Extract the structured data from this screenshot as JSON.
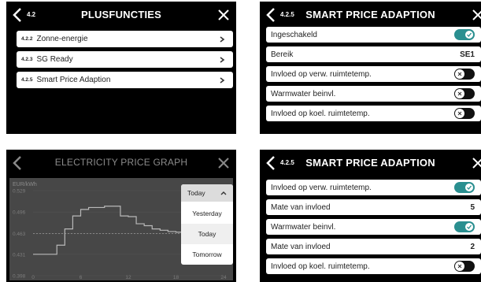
{
  "panel_plus": {
    "section": "4.2",
    "title": "PLUSFUNCTIES",
    "items": [
      {
        "num": "4.2.2",
        "label": "Zonne-energie"
      },
      {
        "num": "4.2.3",
        "label": "SG Ready"
      },
      {
        "num": "4.2.5",
        "label": "Smart Price Adaption"
      }
    ]
  },
  "panel_spa1": {
    "section": "4.2.5",
    "title": "SMART PRICE ADAPTION",
    "rows": [
      {
        "label": "Ingeschakeld",
        "toggle": "on"
      },
      {
        "label": "Bereik",
        "value": "SE1"
      },
      {
        "label": "Invloed op verw. ruimtetemp.",
        "toggle": "off"
      },
      {
        "label": "Warmwater beinvl.",
        "toggle": "off"
      },
      {
        "label": "Invloed op koel. ruimtetemp.",
        "toggle": "off"
      }
    ]
  },
  "panel_graph": {
    "title": "ELECTRICITY PRICE GRAPH",
    "unit": "EUR/kWh",
    "dropdown": {
      "selected": "Today",
      "options": [
        "Yesterday",
        "Today",
        "Tomorrow"
      ]
    }
  },
  "panel_spa2": {
    "section": "4.2.5",
    "title": "SMART PRICE ADAPTION",
    "rows": [
      {
        "label": "Invloed op verw. ruimtetemp.",
        "toggle": "on"
      },
      {
        "label": "Mate van invloed",
        "value": "5"
      },
      {
        "label": "Warmwater beinvl.",
        "toggle": "on"
      },
      {
        "label": "Mate van invloed",
        "value": "2"
      },
      {
        "label": "Invloed op koel. ruimtetemp.",
        "toggle": "off"
      }
    ]
  },
  "chart_data": {
    "type": "line",
    "ylabel": "EUR/kWh",
    "yticks": [
      "0.529",
      "0.496",
      "0.463",
      "0.431",
      "0.398"
    ],
    "xticks": [
      "0",
      "6",
      "12",
      "18",
      "24"
    ],
    "ylim": [
      0.398,
      0.529
    ],
    "xlim": [
      0,
      24
    ],
    "x": [
      0,
      2,
      3,
      4,
      5,
      6,
      7,
      8,
      9,
      10,
      11,
      12,
      13,
      14,
      15,
      16,
      17,
      18,
      19,
      20,
      21,
      22,
      23,
      24
    ],
    "values": [
      0.431,
      0.431,
      0.445,
      0.47,
      0.49,
      0.5,
      0.503,
      0.503,
      0.505,
      0.505,
      0.49,
      0.489,
      0.478,
      0.475,
      0.47,
      0.468,
      0.466,
      0.465,
      0.465,
      0.456,
      0.456,
      0.45,
      0.445,
      0.445
    ],
    "reference_line": 0.463,
    "grid": true,
    "series": [
      {
        "name": "",
        "color": "#b8b8b8"
      }
    ]
  },
  "colors": {
    "accent": "#2a8f90",
    "screen_bg": "#000000",
    "row_bg": "#ffffff"
  }
}
